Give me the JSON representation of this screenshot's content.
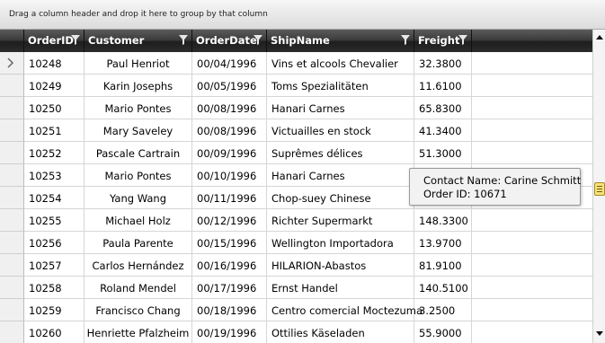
{
  "group_panel": {
    "hint": "Drag a column header and drop it here to group by that column"
  },
  "columns": [
    {
      "key": "order_id",
      "label": "OrderID",
      "filter_icon": "filter-icon"
    },
    {
      "key": "customer",
      "label": "Customer",
      "filter_icon": "filter-icon"
    },
    {
      "key": "order_date",
      "label": "OrderDate",
      "filter_icon": "filter-icon"
    },
    {
      "key": "ship_name",
      "label": "ShipName",
      "filter_icon": "filter-icon"
    },
    {
      "key": "freight",
      "label": "Freight",
      "filter_icon": "filter-icon"
    }
  ],
  "rows": [
    {
      "order_id": "10248",
      "customer": "Paul Henriot",
      "order_date": "00/04/1996",
      "ship_name": "Vins et alcools Chevalier",
      "freight": "32.3800",
      "current": true
    },
    {
      "order_id": "10249",
      "customer": "Karin Josephs",
      "order_date": "00/05/1996",
      "ship_name": "Toms Spezialitäten",
      "freight": "11.6100"
    },
    {
      "order_id": "10250",
      "customer": "Mario Pontes",
      "order_date": "00/08/1996",
      "ship_name": "Hanari Carnes",
      "freight": "65.8300"
    },
    {
      "order_id": "10251",
      "customer": "Mary Saveley",
      "order_date": "00/08/1996",
      "ship_name": "Victuailles en stock",
      "freight": "41.3400"
    },
    {
      "order_id": "10252",
      "customer": "Pascale Cartrain",
      "order_date": "00/09/1996",
      "ship_name": "Suprêmes délices",
      "freight": "51.3000"
    },
    {
      "order_id": "10253",
      "customer": "Mario Pontes",
      "order_date": "00/10/1996",
      "ship_name": "Hanari Carnes",
      "freight": ""
    },
    {
      "order_id": "10254",
      "customer": "Yang Wang",
      "order_date": "00/11/1996",
      "ship_name": "Chop-suey Chinese",
      "freight": ""
    },
    {
      "order_id": "10255",
      "customer": "Michael Holz",
      "order_date": "00/12/1996",
      "ship_name": "Richter Supermarkt",
      "freight": "148.3300"
    },
    {
      "order_id": "10256",
      "customer": "Paula Parente",
      "order_date": "00/15/1996",
      "ship_name": "Wellington Importadora",
      "freight": "13.9700"
    },
    {
      "order_id": "10257",
      "customer": "Carlos Hernández",
      "order_date": "00/16/1996",
      "ship_name": "HILARION-Abastos",
      "freight": "81.9100"
    },
    {
      "order_id": "10258",
      "customer": "Roland Mendel",
      "order_date": "00/17/1996",
      "ship_name": "Ernst Handel",
      "freight": "140.5100"
    },
    {
      "order_id": "10259",
      "customer": "Francisco Chang",
      "order_date": "00/18/1996",
      "ship_name": "Centro comercial Moctezuma",
      "freight": "3.2500"
    },
    {
      "order_id": "10260",
      "customer": "Henriette Pfalzheim",
      "order_date": "00/19/1996",
      "ship_name": "Ottilies Käseladen",
      "freight": "55.9000"
    }
  ],
  "tooltip": {
    "line1": "Contact Name: Carine Schmitt",
    "line2": "Order ID: 10671"
  },
  "scrollbar": {
    "up_icon": "scroll-up-arrow-icon",
    "down_icon": "scroll-down-arrow-icon",
    "thumb_icon": "scroll-thumb-grip-icon"
  },
  "colors": {
    "header_dark": "#2b2b2b",
    "header_text": "#ffffff",
    "grid_line": "#d6d6d6",
    "thumb": "#f6e27a"
  }
}
